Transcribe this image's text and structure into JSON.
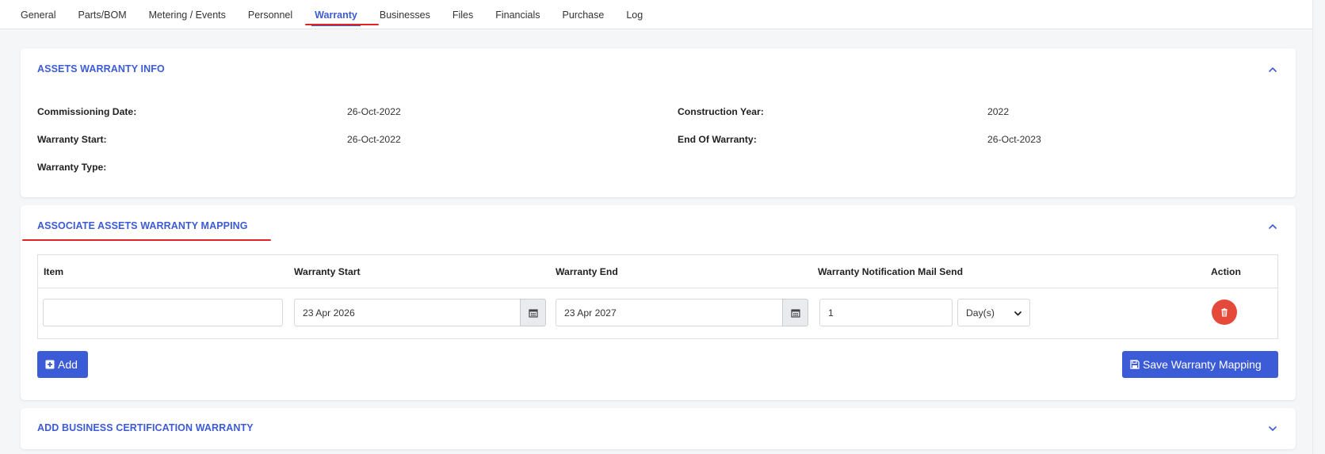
{
  "tabs": [
    {
      "label": "General"
    },
    {
      "label": "Parts/BOM"
    },
    {
      "label": "Metering / Events"
    },
    {
      "label": "Personnel"
    },
    {
      "label": "Warranty",
      "active": true
    },
    {
      "label": "Businesses"
    },
    {
      "label": "Files"
    },
    {
      "label": "Financials"
    },
    {
      "label": "Purchase"
    },
    {
      "label": "Log"
    }
  ],
  "warranty_info": {
    "title": "ASSETS WARRANTY INFO",
    "commissioning_date_label": "Commissioning Date:",
    "commissioning_date_value": "26-Oct-2022",
    "construction_year_label": "Construction Year:",
    "construction_year_value": "2022",
    "warranty_start_label": "Warranty Start:",
    "warranty_start_value": "26-Oct-2022",
    "end_of_warranty_label": "End Of Warranty:",
    "end_of_warranty_value": "26-Oct-2023",
    "warranty_type_label": "Warranty Type:",
    "warranty_type_value": ""
  },
  "mapping": {
    "title": "ASSOCIATE ASSETS WARRANTY MAPPING",
    "headers": {
      "item": "Item",
      "warranty_start": "Warranty Start",
      "warranty_end": "Warranty End",
      "notification": "Warranty Notification Mail Send",
      "action": "Action"
    },
    "row": {
      "item_value": "",
      "warranty_start_value": "23 Apr 2026",
      "warranty_end_value": "23 Apr 2027",
      "notification_value": "1",
      "unit_selected": "Day(s)"
    },
    "add_label": "Add",
    "save_label": "Save Warranty Mapping"
  },
  "business_certification": {
    "title": "ADD BUSINESS CERTIFICATION WARRANTY"
  },
  "colors": {
    "accent": "#3c5bd6",
    "danger": "#e5493a",
    "highlight": "#e02424"
  }
}
